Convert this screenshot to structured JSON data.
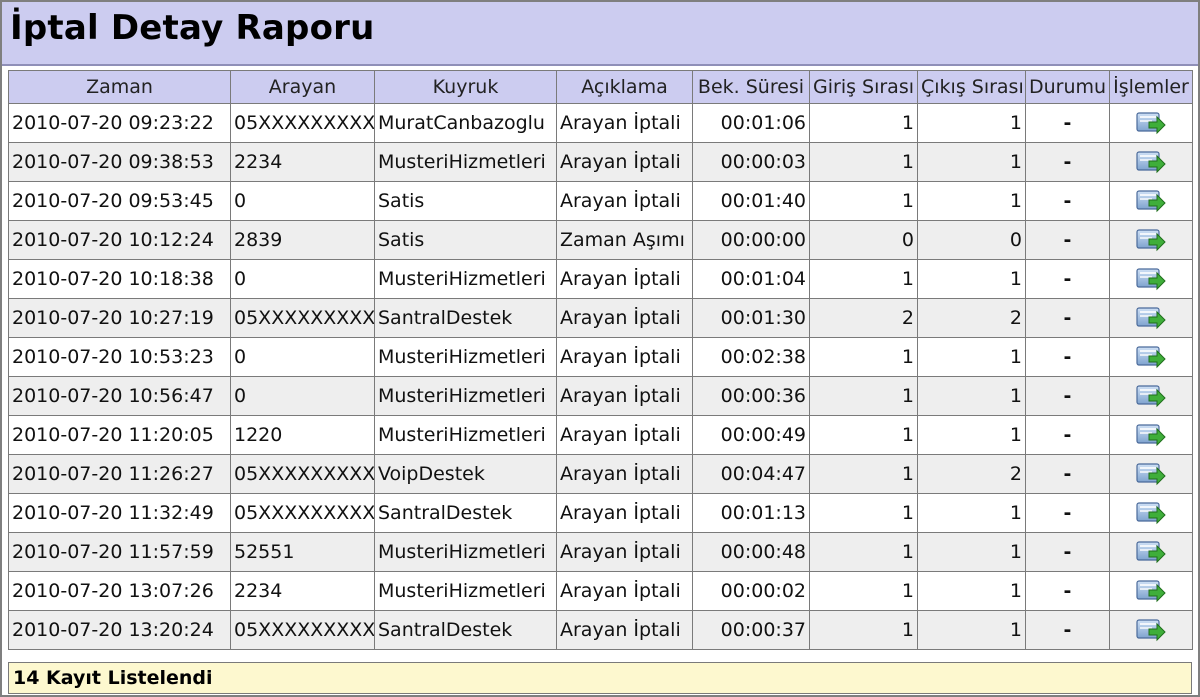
{
  "page": {
    "title": "İptal Detay Raporu"
  },
  "table": {
    "columns": [
      "Zaman",
      "Arayan",
      "Kuyruk",
      "Açıklama",
      "Bek. Süresi",
      "Giriş Sırası",
      "Çıkış Sırası",
      "Durumu",
      "İşlemler"
    ],
    "rows": [
      [
        "2010-07-20 09:23:22",
        "05XXXXXXXXX",
        "MuratCanbazoglu",
        "Arayan İptali",
        "00:01:06",
        "1",
        "1",
        "-"
      ],
      [
        "2010-07-20 09:38:53",
        "2234",
        "MusteriHizmetleri",
        "Arayan İptali",
        "00:00:03",
        "1",
        "1",
        "-"
      ],
      [
        "2010-07-20 09:53:45",
        "0",
        "Satis",
        "Arayan İptali",
        "00:01:40",
        "1",
        "1",
        "-"
      ],
      [
        "2010-07-20 10:12:24",
        "2839",
        "Satis",
        "Zaman Aşımı",
        "00:00:00",
        "0",
        "0",
        "-"
      ],
      [
        "2010-07-20 10:18:38",
        "0",
        "MusteriHizmetleri",
        "Arayan İptali",
        "00:01:04",
        "1",
        "1",
        "-"
      ],
      [
        "2010-07-20 10:27:19",
        "05XXXXXXXXX",
        "SantralDestek",
        "Arayan İptali",
        "00:01:30",
        "2",
        "2",
        "-"
      ],
      [
        "2010-07-20 10:53:23",
        "0",
        "MusteriHizmetleri",
        "Arayan İptali",
        "00:02:38",
        "1",
        "1",
        "-"
      ],
      [
        "2010-07-20 10:56:47",
        "0",
        "MusteriHizmetleri",
        "Arayan İptali",
        "00:00:36",
        "1",
        "1",
        "-"
      ],
      [
        "2010-07-20 11:20:05",
        "1220",
        "MusteriHizmetleri",
        "Arayan İptali",
        "00:00:49",
        "1",
        "1",
        "-"
      ],
      [
        "2010-07-20 11:26:27",
        "05XXXXXXXXX",
        "VoipDestek",
        "Arayan İptali",
        "00:04:47",
        "1",
        "2",
        "-"
      ],
      [
        "2010-07-20 11:32:49",
        "05XXXXXXXXX",
        "SantralDestek",
        "Arayan İptali",
        "00:01:13",
        "1",
        "1",
        "-"
      ],
      [
        "2010-07-20 11:57:59",
        "52551",
        "MusteriHizmetleri",
        "Arayan İptali",
        "00:00:48",
        "1",
        "1",
        "-"
      ],
      [
        "2010-07-20 13:07:26",
        "2234",
        "MusteriHizmetleri",
        "Arayan İptali",
        "00:00:02",
        "1",
        "1",
        "-"
      ],
      [
        "2010-07-20 13:20:24",
        "05XXXXXXXXX",
        "SantralDestek",
        "Arayan İptali",
        "00:00:37",
        "1",
        "1",
        "-"
      ]
    ],
    "action_icon": "export-arrow-icon"
  },
  "footer": {
    "summary": "14 Kayıt Listelendi"
  },
  "colors": {
    "header_bg": "#ccccf0",
    "footer_bg": "#fdf8cf",
    "status_dash": "#e02020",
    "row_alt": "#eeeeee"
  }
}
